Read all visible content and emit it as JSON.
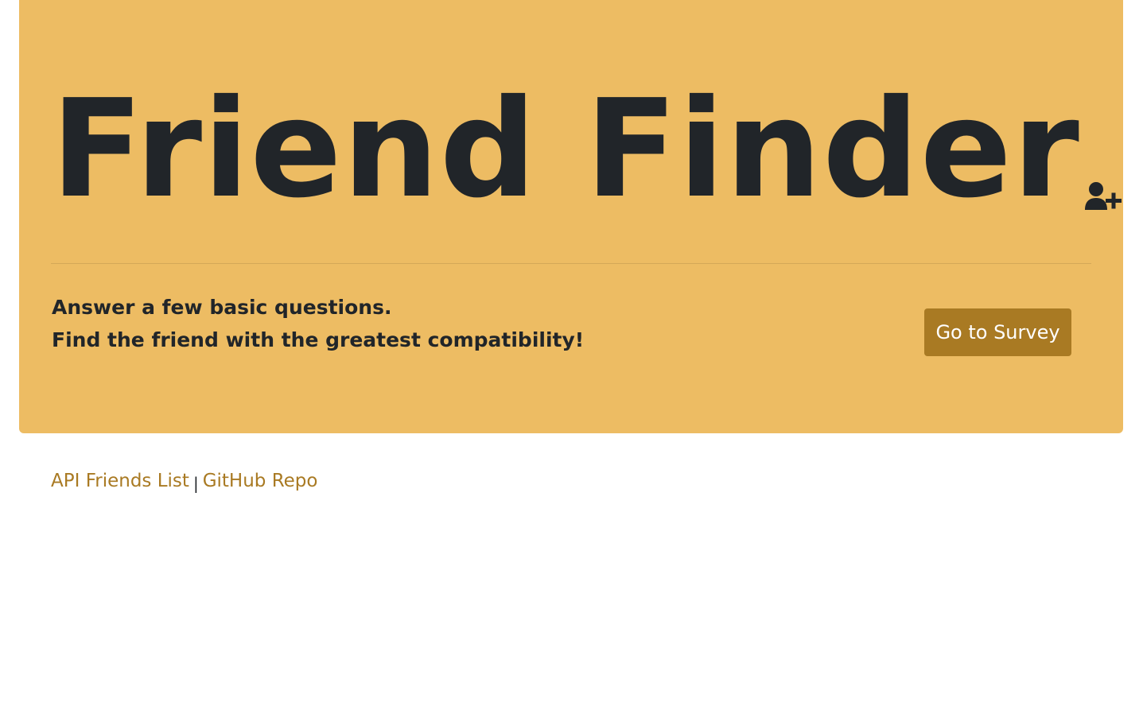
{
  "jumbotron": {
    "title": "Friend Finder",
    "title_icon": "user-plus-icon",
    "tagline_line1": "Answer a few basic questions.",
    "tagline_line2": "Find the friend with the greatest compatibility!",
    "survey_button_label": "Go to Survey"
  },
  "footer": {
    "api_link_label": "API Friends List",
    "separator": "|",
    "github_link_label": "GitHub Repo"
  },
  "colors": {
    "jumbotron_background": "#edbc63",
    "button_background": "#a97a23",
    "link": "#a97a23",
    "text": "#212529"
  }
}
